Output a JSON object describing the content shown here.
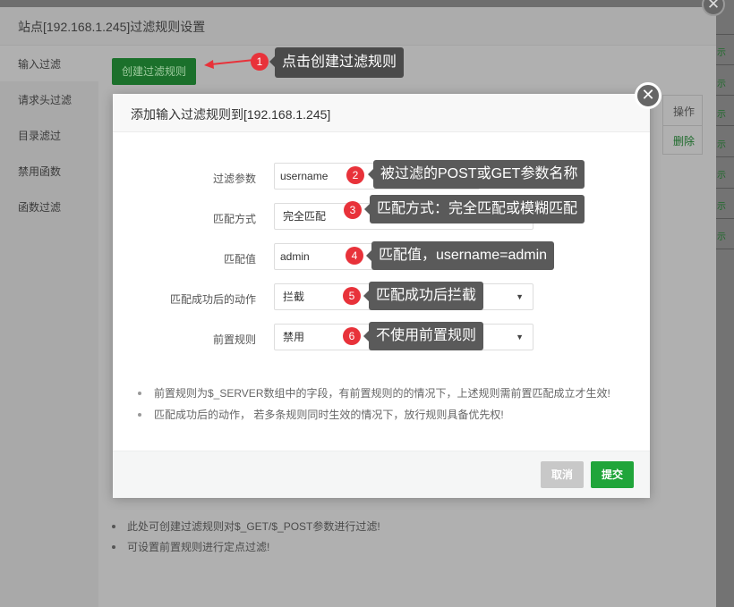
{
  "outer_dialog": {
    "title": "站点[192.168.1.245]过滤规则设置",
    "close_icon": "✕",
    "sidebar": [
      {
        "label": "输入过滤",
        "active": true
      },
      {
        "label": "请求头过滤"
      },
      {
        "label": "目录滤过"
      },
      {
        "label": "禁用函数"
      },
      {
        "label": "函数过滤"
      }
    ],
    "create_button": "创建过滤规则",
    "table": {
      "header_action": "操作",
      "row_action": "删除"
    },
    "notes": [
      "此处可创建过滤规则对$_GET/$_POST参数进行过滤!",
      "可设置前置规则进行定点过滤!"
    ]
  },
  "modal": {
    "title": "添加输入过滤规则到[192.168.1.245]",
    "close_icon": "✕",
    "fields": [
      {
        "label": "过滤参数",
        "value": "username",
        "type": "input"
      },
      {
        "label": "匹配方式",
        "value": "完全匹配",
        "type": "select"
      },
      {
        "label": "匹配值",
        "value": "admin",
        "type": "input"
      },
      {
        "label": "匹配成功后的动作",
        "value": "拦截",
        "type": "select"
      },
      {
        "label": "前置规则",
        "value": "禁用",
        "type": "select"
      }
    ],
    "select_caret": "▼",
    "notes": [
      "前置规则为$_SERVER数组中的字段，有前置规则的的情况下，上述规则需前置匹配成立才生效!",
      "匹配成功后的动作， 若多条规则同时生效的情况下，放行规则具备优先权!"
    ],
    "cancel_button": "取消",
    "submit_button": "提交"
  },
  "annotations": [
    {
      "number": "1",
      "text": "点击创建过滤规则"
    },
    {
      "number": "2",
      "text": "被过滤的POST或GET参数名称"
    },
    {
      "number": "3",
      "text": "匹配方式：完全匹配或模糊匹配"
    },
    {
      "number": "4",
      "text": "匹配值，username=admin"
    },
    {
      "number": "5",
      "text": "匹配成功后拦截"
    },
    {
      "number": "6",
      "text": "不使用前置规则"
    }
  ],
  "background": {
    "right_edge_marks": [
      "示",
      "示",
      "示",
      "示",
      "示",
      "示",
      "示"
    ]
  },
  "colors": {
    "primary_green": "#20a53a",
    "badge_red": "#e8323a",
    "tip_bg": "#5a5a5a"
  }
}
